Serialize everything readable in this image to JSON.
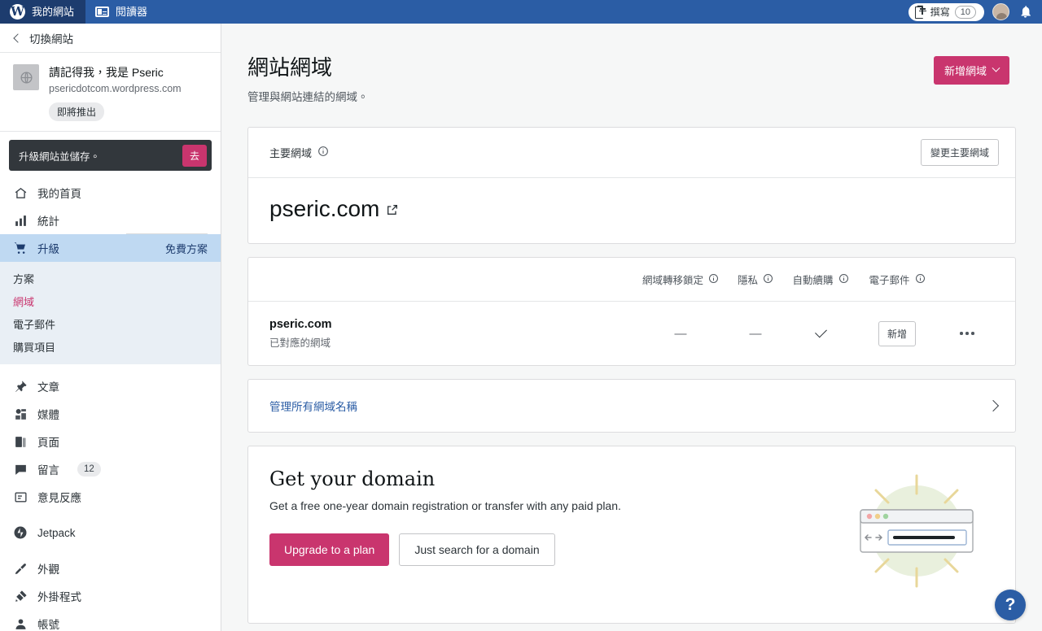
{
  "masthead": {
    "tabs": [
      {
        "label": "我的網站",
        "icon": "wordpress-logo-icon",
        "active": true
      },
      {
        "label": "閱讀器",
        "icon": "reader-icon",
        "active": false
      }
    ],
    "write_label": "撰寫",
    "write_icon": "compose-icon",
    "write_count": "10",
    "avatar_icon": "avatar",
    "bell_icon": "bell-icon"
  },
  "sidebar": {
    "switch_site_label": "切換網站",
    "back_icon": "chevron-left-icon",
    "site": {
      "name": "請記得我，我是 Pseric",
      "url": "psericdotcom.wordpress.com",
      "badge": "即將推出",
      "thumb_icon": "site-globe-icon"
    },
    "upgrade_banner": {
      "text": "升級網站並儲存。",
      "button": "去"
    },
    "nav": [
      {
        "label": "我的首頁",
        "icon": "home-icon"
      },
      {
        "label": "統計",
        "icon": "stats-bar-icon"
      },
      {
        "label": "升級",
        "icon": "cart-icon",
        "meta": "免費方案",
        "selected": true
      }
    ],
    "subnav": [
      {
        "label": "方案"
      },
      {
        "label": "網域",
        "active": true
      },
      {
        "label": "電子郵件"
      },
      {
        "label": "購買項目"
      }
    ],
    "nav2": [
      {
        "label": "文章",
        "icon": "pin-icon"
      },
      {
        "label": "媒體",
        "icon": "media-icon"
      },
      {
        "label": "頁面",
        "icon": "pages-icon"
      },
      {
        "label": "留言",
        "icon": "comment-icon",
        "count": "12"
      },
      {
        "label": "意見反應",
        "icon": "feedback-icon"
      }
    ],
    "nav3": [
      {
        "label": "Jetpack",
        "icon": "jetpack-icon"
      }
    ],
    "nav4": [
      {
        "label": "外觀",
        "icon": "appearance-brush-icon"
      },
      {
        "label": "外掛程式",
        "icon": "plugin-icon"
      },
      {
        "label": "帳號",
        "icon": "user-icon"
      }
    ]
  },
  "page": {
    "title": "網站網域",
    "subtitle": "管理與網站連結的網域。",
    "add_domain_label": "新增網域",
    "add_domain_icon": "chevron-down-icon"
  },
  "primary_card": {
    "label": "主要網域",
    "info_icon": "info-icon",
    "change_button": "變更主要網域",
    "domain": "pseric.com",
    "external_icon": "external-link-icon"
  },
  "domains_table": {
    "columns": [
      {
        "label": "網域轉移鎖定",
        "info_icon": "info-icon"
      },
      {
        "label": "隱私",
        "info_icon": "info-icon"
      },
      {
        "label": "自動續購",
        "info_icon": "info-icon"
      },
      {
        "label": "電子郵件",
        "info_icon": "info-icon"
      }
    ],
    "rows": [
      {
        "domain": "pseric.com",
        "status": "已對應的網域",
        "transfer_lock": "—",
        "privacy": "—",
        "auto_renew": "check-icon",
        "email_button": "新增",
        "menu_icon": "ellipsis-icon"
      }
    ]
  },
  "manage_all": {
    "label": "管理所有網域名稱",
    "icon": "chevron-right-icon"
  },
  "promo": {
    "title": "Get your domain",
    "subtitle": "Get a free one-year domain registration or transfer with any paid plan.",
    "primary_button": "Upgrade to a plan",
    "secondary_button": "Just search for a domain",
    "illustration": "browser-window-illustration"
  },
  "help": {
    "label": "?",
    "icon": "help-icon"
  },
  "colors": {
    "masthead_blue": "#2b5da5",
    "masthead_active": "#1d3c6e",
    "accent_pink": "#c9356e",
    "selected_nav": "#bfd9f2",
    "subnav_bg": "#e9eff5",
    "page_bg": "#f6f7f7",
    "banner_dark": "#32373c"
  }
}
